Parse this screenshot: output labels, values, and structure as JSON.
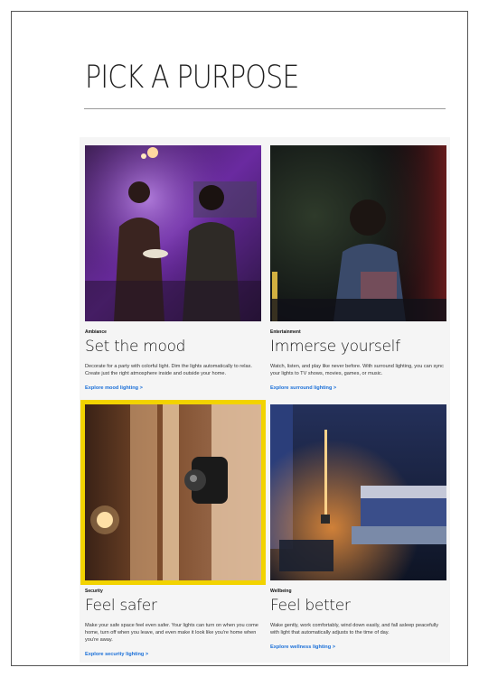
{
  "page": {
    "title": "PICK A PURPOSE"
  },
  "cards": [
    {
      "category": "Ambiance",
      "heading": "Set the mood",
      "description": "Decorate for a party with colorful light. Dim the lights automatically to relax. Create just the right atmosphere inside and outside your home.",
      "link": "Explore mood lighting >"
    },
    {
      "category": "Entertainment",
      "heading": "Immerse yourself",
      "description": "Watch, listen, and play like never before. With surround lighting, you can sync your lights to TV shows, movies, games, or music.",
      "link": "Explore surround lighting >"
    },
    {
      "category": "Security",
      "heading": "Feel safer",
      "description": "Make your safe space feel even safer. Your lights can turn on when you come home, turn off when you leave, and even make it look like you're home when you're away.",
      "link": "Explore security lighting >"
    },
    {
      "category": "Wellbeing",
      "heading": "Feel better",
      "description": "Wake gently, work comfortably, wind down easily, and fall asleep peacefully with light that automatically adjusts to the time of day.",
      "link": "Explore wellness lighting >"
    }
  ],
  "colors": {
    "accent_link": "#1a6fd8",
    "highlight_border": "#f2d300"
  }
}
